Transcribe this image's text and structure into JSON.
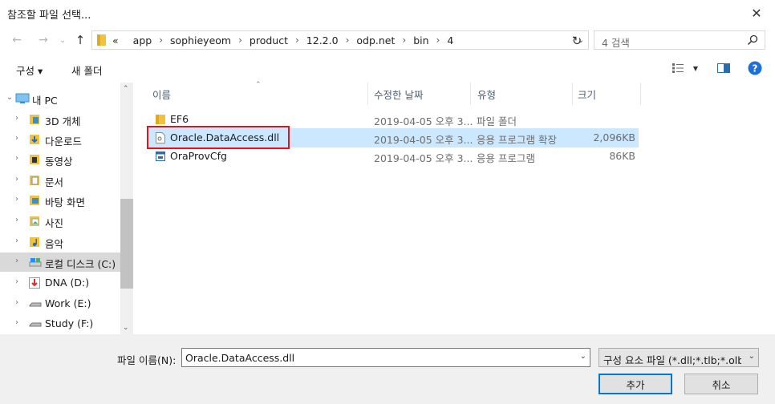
{
  "window": {
    "title": "참조할 파일 선택...",
    "close_glyph": "✕"
  },
  "address": {
    "overflow_glyph": "«",
    "crumbs": [
      "app",
      "sophieyeom",
      "product",
      "12.2.0",
      "odp.net",
      "bin",
      "4"
    ],
    "separator": "›"
  },
  "search": {
    "placeholder": "4 검색"
  },
  "toolbar": {
    "organize_label": "구성 ▾",
    "newfolder_label": "새 폴더"
  },
  "nav": {
    "items": [
      {
        "label": "내 PC",
        "icon": "pc-icon",
        "expanded": true
      },
      {
        "label": "3D 개체",
        "icon": "3d-objects-icon"
      },
      {
        "label": "다운로드",
        "icon": "downloads-icon"
      },
      {
        "label": "동영상",
        "icon": "videos-icon"
      },
      {
        "label": "문서",
        "icon": "documents-icon"
      },
      {
        "label": "바탕 화면",
        "icon": "desktop-icon"
      },
      {
        "label": "사진",
        "icon": "pictures-icon"
      },
      {
        "label": "음악",
        "icon": "music-icon"
      },
      {
        "label": "로컬 디스크 (C:)",
        "icon": "local-disk-icon",
        "selected": true
      },
      {
        "label": "DNA (D:)",
        "icon": "dna-drive-icon"
      },
      {
        "label": "Work (E:)",
        "icon": "drive-icon"
      },
      {
        "label": "Study (F:)",
        "icon": "drive-icon"
      }
    ]
  },
  "columns": {
    "name": "이름",
    "date": "수정한 날짜",
    "type": "유형",
    "size": "크기"
  },
  "files": [
    {
      "name": "EF6",
      "date": "2019-04-05 오후 3...",
      "type": "파일 폴더",
      "size": "",
      "icon": "folder-icon"
    },
    {
      "name": "Oracle.DataAccess.dll",
      "date": "2019-04-05 오후 3...",
      "type": "응용 프로그램 확장",
      "size": "2,096KB",
      "icon": "dll-file-icon",
      "selected": true
    },
    {
      "name": "OraProvCfg",
      "date": "2019-04-05 오후 3...",
      "type": "응용 프로그램",
      "size": "86KB",
      "icon": "exe-file-icon"
    }
  ],
  "bottom": {
    "filename_label": "파일 이름(N):",
    "filename_value": "Oracle.DataAccess.dll",
    "filetype_value": "구성 요소 파일 (*.dll;*.tlb;*.olb;*",
    "add_label": "추가",
    "cancel_label": "취소"
  },
  "colors": {
    "selection": "#cce8ff",
    "highlight_border": "#e8111b",
    "accent": "#0078d7"
  }
}
